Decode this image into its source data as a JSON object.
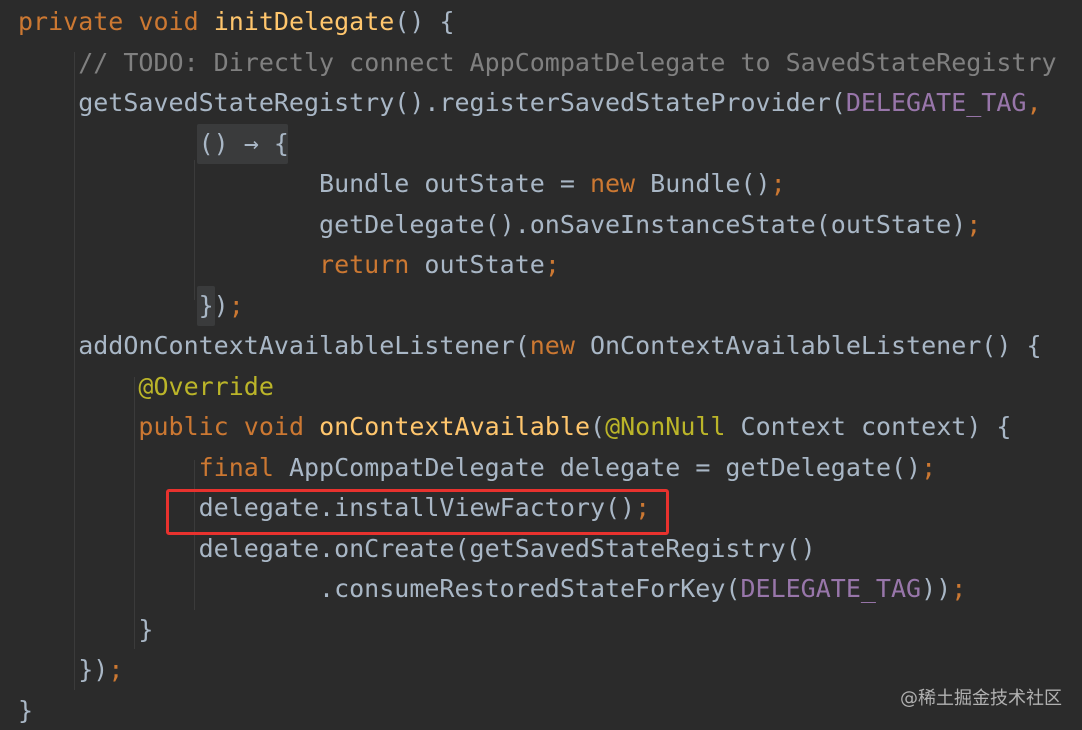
{
  "editor": {
    "lines": [
      [
        {
          "t": "private",
          "c": "kw"
        },
        {
          "t": " "
        },
        {
          "t": "void",
          "c": "kw"
        },
        {
          "t": " "
        },
        {
          "t": "initDelegate",
          "c": "fn"
        },
        {
          "t": "() {"
        }
      ],
      [
        {
          "t": "    "
        },
        {
          "t": "// TODO: Directly connect AppCompatDelegate to SavedStateRegistry",
          "c": "cm"
        }
      ],
      [
        {
          "t": "    getSavedStateRegistry().registerSavedStateProvider("
        },
        {
          "t": "DELEGATE_TAG",
          "c": "cst"
        },
        {
          "t": ",",
          "c": "punc"
        }
      ],
      [
        {
          "t": "            () → {"
        }
      ],
      [
        {
          "t": "                    Bundle outState = "
        },
        {
          "t": "new",
          "c": "kw"
        },
        {
          "t": " Bundle()"
        },
        {
          "t": ";",
          "c": "punc"
        }
      ],
      [
        {
          "t": "                    getDelegate().onSaveInstanceState(outState)"
        },
        {
          "t": ";",
          "c": "punc"
        }
      ],
      [
        {
          "t": "                    "
        },
        {
          "t": "return",
          "c": "kw"
        },
        {
          "t": " outState"
        },
        {
          "t": ";",
          "c": "punc"
        }
      ],
      [
        {
          "t": "            })"
        },
        {
          "t": ";",
          "c": "punc"
        }
      ],
      [
        {
          "t": "    addOnContextAvailableListener("
        },
        {
          "t": "new",
          "c": "kw"
        },
        {
          "t": " OnContextAvailableListener() {"
        }
      ],
      [
        {
          "t": "        "
        },
        {
          "t": "@Override",
          "c": "ann"
        }
      ],
      [
        {
          "t": "        "
        },
        {
          "t": "public",
          "c": "kw"
        },
        {
          "t": " "
        },
        {
          "t": "void",
          "c": "kw"
        },
        {
          "t": " "
        },
        {
          "t": "onContextAvailable",
          "c": "fn"
        },
        {
          "t": "("
        },
        {
          "t": "@NonNull",
          "c": "ann"
        },
        {
          "t": " Context context) {"
        }
      ],
      [
        {
          "t": "            "
        },
        {
          "t": "final",
          "c": "kw"
        },
        {
          "t": " AppCompatDelegate delegate = getDelegate()"
        },
        {
          "t": ";",
          "c": "punc"
        }
      ],
      [
        {
          "t": "            delegate.installViewFactory()"
        },
        {
          "t": ";",
          "c": "punc"
        }
      ],
      [
        {
          "t": "            delegate.onCreate(getSavedStateRegistry()"
        }
      ],
      [
        {
          "t": "                    .consumeRestoredStateForKey("
        },
        {
          "t": "DELEGATE_TAG",
          "c": "cst"
        },
        {
          "t": "))"
        },
        {
          "t": ";",
          "c": "punc"
        }
      ],
      [
        {
          "t": "        }"
        }
      ],
      [
        {
          "t": "    })"
        },
        {
          "t": ";",
          "c": "punc"
        }
      ],
      [
        {
          "t": "}"
        }
      ]
    ]
  },
  "highlight": {
    "line_index": 12,
    "color": "#e8322e"
  },
  "watermark": "@稀土掘金技术社区",
  "colors": {
    "background": "#2b2b2b",
    "default": "#a9b7c6",
    "keyword": "#cc7832",
    "function": "#ffc66d",
    "comment": "#808080",
    "constant": "#9876aa",
    "annotation": "#bbb529"
  }
}
